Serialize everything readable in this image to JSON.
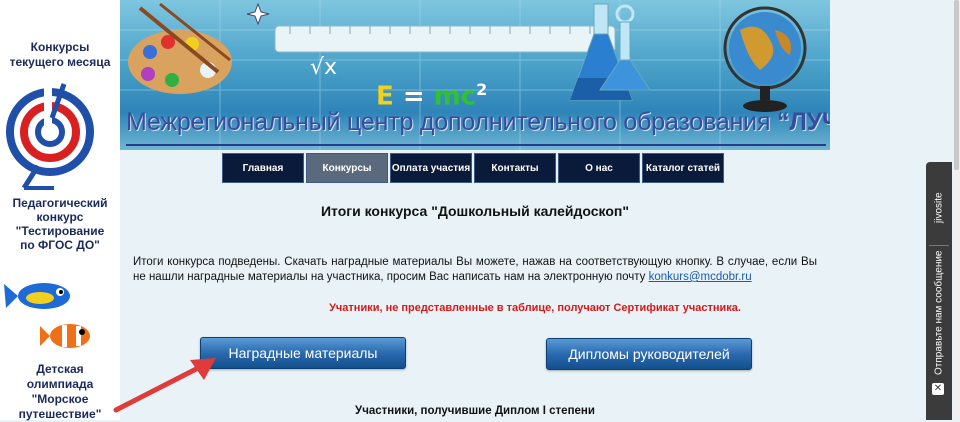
{
  "sidebar": {
    "contests_title": "Конкурсы\nтекущего месяца",
    "promo1": "Педагогический\nконкурс\n\"Тестирование\nпо ФГОС ДО\"",
    "promo2": "Детская\nолимпиада\n\"Морское\nпутешествие\""
  },
  "header": {
    "formula": "E = mc²",
    "title_prefix": "Межрегиональный центр дополнительного образования ",
    "title_brand": "“ЛУЧ”"
  },
  "nav": {
    "items": [
      {
        "label": "Главная"
      },
      {
        "label": "Конкурсы"
      },
      {
        "label": "Оплата участия"
      },
      {
        "label": "Контакты"
      },
      {
        "label": "О нас"
      },
      {
        "label": "Каталог статей"
      }
    ]
  },
  "content": {
    "page_title": "Итоги конкурса \"Дошкольный калейдоскоп\"",
    "intro_text": "Итоги конкурса подведены. Скачать наградные материалы Вы можете, нажав на соответствующую кнопку. В случае, если Вы не нашли наградные материалы на участника, просим Вас написать нам на электронную почту ",
    "email": "konkurs@mcdobr.ru",
    "warning": "Учатники, не представленные в таблице, получают Сертификат участника.",
    "btn_awards": "Наградные материалы",
    "btn_diplomas": "Дипломы руководителей",
    "bottom_heading": "Участники, получившие Диплом I степени"
  },
  "chat_widget": {
    "brand": "jivosite",
    "label": "Отправьте нам сообщение"
  },
  "colors": {
    "nav_bg": "#0a1a3a",
    "nav_active": "#5a6a7c",
    "button_blue": "#2a6aae",
    "warning_red": "#d61a1a",
    "link_blue": "#1a5ab0",
    "title_blue": "#3a4a9c"
  }
}
